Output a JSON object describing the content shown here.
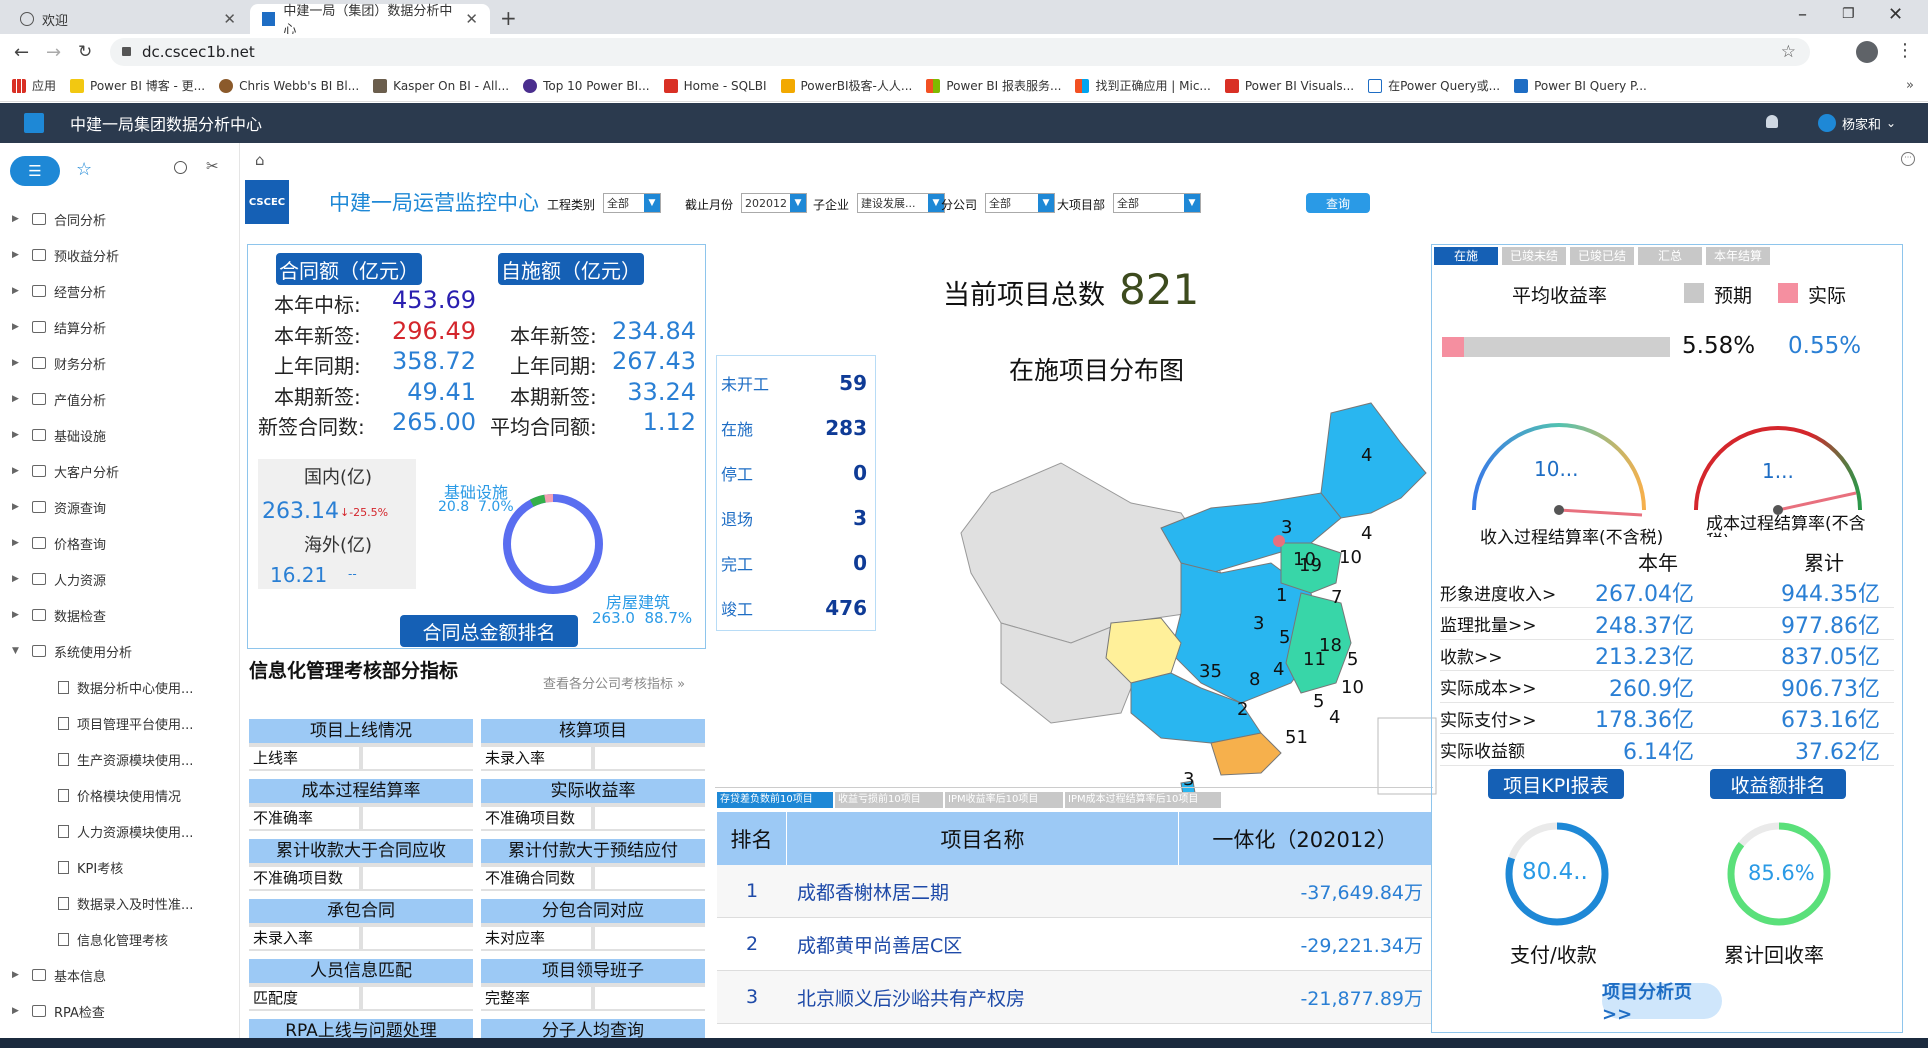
{
  "browser": {
    "tabs": [
      {
        "label": "欢迎",
        "active": false
      },
      {
        "label": "中建一局（集团）数据分析中心",
        "active": true
      }
    ],
    "url": "dc.cscec1b.net",
    "bookmarks": [
      "应用",
      "Power BI 博客 - 更...",
      "Chris Webb's BI Bl...",
      "Kasper On BI - All...",
      "Top 10 Power BI...",
      "Home - SQLBI",
      "PowerBI极客-人人...",
      "Power BI 报表服务...",
      "找到正确应用 | Mic...",
      "Power BI Visuals...",
      "在Power Query或...",
      "Power BI Query P..."
    ]
  },
  "app": {
    "title": "中建一局集团数据分析中心",
    "user": "杨家和"
  },
  "sidebar": {
    "items": [
      {
        "label": "合同分析",
        "expanded": false
      },
      {
        "label": "预收益分析",
        "expanded": false
      },
      {
        "label": "经营分析",
        "expanded": false
      },
      {
        "label": "结算分析",
        "expanded": false
      },
      {
        "label": "财务分析",
        "expanded": false
      },
      {
        "label": "产值分析",
        "expanded": false
      },
      {
        "label": "基础设施",
        "expanded": false
      },
      {
        "label": "大客户分析",
        "expanded": false
      },
      {
        "label": "资源查询",
        "expanded": false
      },
      {
        "label": "价格查询",
        "expanded": false
      },
      {
        "label": "人力资源",
        "expanded": false
      },
      {
        "label": "数据检查",
        "expanded": false
      },
      {
        "label": "系统使用分析",
        "expanded": true
      }
    ],
    "subitems": [
      "数据分析中心使用...",
      "项目管理平台使用...",
      "生产资源模块使用...",
      "价格模块使用情况",
      "人力资源模块使用...",
      "KPI考核",
      "数据录入及时性准...",
      "信息化管理考核"
    ],
    "tail_items": [
      "基本信息",
      "RPA检查"
    ]
  },
  "report": {
    "logo_text": "CSCEC",
    "title": "中建一局运营监控中心",
    "filters": [
      {
        "label": "工程类别",
        "value": "全部"
      },
      {
        "label": "截止月份",
        "value": "202012"
      },
      {
        "label": "子企业",
        "value": "建设发展..."
      },
      {
        "label": "分公司",
        "value": "全部"
      },
      {
        "label": "大项目部",
        "value": "全部"
      }
    ],
    "query_button": "查询",
    "contract": {
      "btn_left": "合同额（亿元）",
      "btn_right": "自施额（亿元）",
      "rows_left": [
        {
          "label": "本年中标:",
          "value": "453.69",
          "color": "#2a1fb0"
        },
        {
          "label": "本年新签:",
          "value": "296.49",
          "color": "#d4262c"
        },
        {
          "label": "上年同期:",
          "value": "358.72",
          "color": "#2a7fd4"
        },
        {
          "label": "本期新签:",
          "value": "49.41",
          "color": "#2a7fd4"
        },
        {
          "label": "新签合同数:",
          "value": "265.00",
          "color": "#2a7fd4"
        }
      ],
      "rows_right": [
        {
          "label": "本年新签:",
          "value": "234.84"
        },
        {
          "label": "上年同期:",
          "value": "267.43"
        },
        {
          "label": "本期新签:",
          "value": "33.24"
        },
        {
          "label": "平均合同额:",
          "value": "1.12"
        }
      ],
      "domestic_label": "国内(亿)",
      "domestic_value": "263.14",
      "domestic_change": "↓-25.5%",
      "overseas_label": "海外(亿)",
      "overseas_value": "16.21",
      "overseas_change": "--",
      "donut_label1": "基础设施",
      "donut_value1": "20.8",
      "donut_pct1": "7.0%",
      "donut_label2": "房屋建筑",
      "donut_value2": "263.0",
      "donut_pct2": "88.7%",
      "rank_button": "合同总金额排名"
    },
    "info_mgmt": {
      "title": "信息化管理考核部分指标",
      "link": "查看各分公司考核指标 »",
      "cells": [
        {
          "head": "项目上线情况",
          "row": "上线率"
        },
        {
          "head": "核算项目",
          "row": "未录入率"
        },
        {
          "head": "成本过程结算率",
          "row": "不准确率"
        },
        {
          "head": "实际收益率",
          "row": "不准确项目数"
        },
        {
          "head": "累计收款大于合同应收",
          "row": "不准确项目数"
        },
        {
          "head": "累计付款大于预结应付",
          "row": "不准确合同数"
        },
        {
          "head": "承包合同",
          "row": "未录入率"
        },
        {
          "head": "分包合同对应",
          "row": "未对应率"
        },
        {
          "head": "人员信息匹配",
          "row": "匹配度"
        },
        {
          "head": "项目领导班子",
          "row": "完整率"
        },
        {
          "head": "RPA上线与问题处理",
          "row": ""
        },
        {
          "head": "分子人均查询",
          "row": ""
        }
      ]
    },
    "project_total_label": "当前项目总数",
    "project_total": "821",
    "map_title": "在施项目分布图",
    "status": [
      {
        "label": "未开工",
        "value": "59"
      },
      {
        "label": "在施",
        "value": "283"
      },
      {
        "label": "停工",
        "value": "0"
      },
      {
        "label": "退场",
        "value": "3"
      },
      {
        "label": "完工",
        "value": "0"
      },
      {
        "label": "竣工",
        "value": "476"
      }
    ],
    "map_numbers": [
      "4",
      "4",
      "3",
      "10",
      "10",
      "19",
      "1",
      "7",
      "3",
      "5",
      "18",
      "11",
      "5",
      "4",
      "8",
      "35",
      "2",
      "10",
      "5",
      "4",
      "51",
      "3"
    ],
    "table": {
      "tabs": [
        "存贷差负数前10项目",
        "收益亏损前10项目",
        "IPM收益率后10项目",
        "IPM成本过程结算率后10项目"
      ],
      "headers": [
        "排名",
        "项目名称",
        "一体化（202012）"
      ],
      "rows": [
        {
          "rank": "1",
          "name": "成都香榭林居二期",
          "value": "-37,649.84万"
        },
        {
          "rank": "2",
          "name": "成都黄甲尚善居C区",
          "value": "-29,221.34万"
        },
        {
          "rank": "3",
          "name": "北京顺义后沙峪共有产权房",
          "value": "-21,877.89万"
        }
      ]
    },
    "right": {
      "tabs": [
        "在施",
        "已竣未结",
        "已竣已结",
        "汇总",
        "本年结算"
      ],
      "avg_label": "平均收益率",
      "legend_expected": "预期",
      "legend_actual": "实际",
      "expected_pct": "5.58%",
      "actual_pct": "0.55%",
      "gauge1_value": "10...",
      "gauge1_label": "收入过程结算率(不含税)",
      "gauge2_value": "1...",
      "gauge2_label": "成本过程结算率(不含税)",
      "col_year": "本年",
      "col_total": "累计",
      "rows": [
        {
          "label": "形象进度收入>",
          "year": "267.04亿",
          "total": "944.35亿"
        },
        {
          "label": "监理批量>>",
          "year": "248.37亿",
          "total": "977.86亿"
        },
        {
          "label": "收款>>",
          "year": "213.23亿",
          "total": "837.05亿"
        },
        {
          "label": "实际成本>>",
          "year": "260.9亿",
          "total": "906.73亿"
        },
        {
          "label": "实际支付>>",
          "year": "178.36亿",
          "total": "673.16亿"
        },
        {
          "label": "实际收益额",
          "year": "6.14亿",
          "total": "37.62亿"
        }
      ],
      "btn_kpi": "项目KPI报表",
      "btn_rank": "收益额排名",
      "ring1_value": "80.4..",
      "ring1_label": "支付/收款",
      "ring2_value": "85.6%",
      "ring2_label": "累计回收率",
      "analysis_button": "项目分析页>>"
    },
    "colors": {
      "accent": "#1e88d6",
      "button": "#1560b5",
      "map_cyan": "#29b6f0",
      "map_green": "#38d6a8",
      "map_yellow": "#fff09a",
      "map_orange": "#f6b04c",
      "map_gray": "#e0e0e0"
    }
  }
}
